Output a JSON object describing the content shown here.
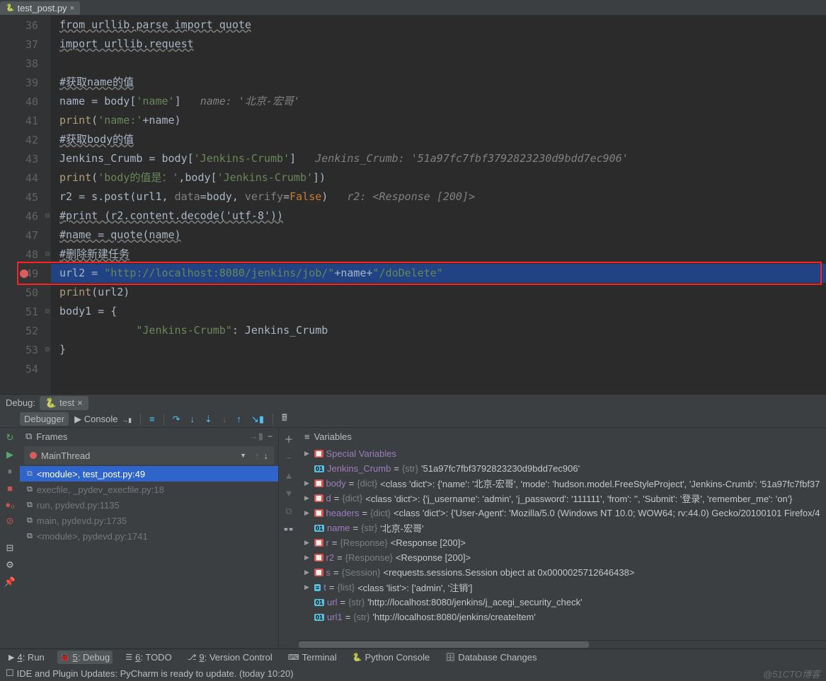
{
  "tab": {
    "filename": "test_post.py"
  },
  "code": {
    "lines": [
      {
        "n": 36,
        "segs": [
          [
            "under",
            "from urllib.parse import quote"
          ]
        ]
      },
      {
        "n": 37,
        "segs": [
          [
            "under",
            "import urllib.request"
          ]
        ]
      },
      {
        "n": 38,
        "segs": []
      },
      {
        "n": 39,
        "segs": [
          [
            "under",
            "#获取name的值"
          ]
        ]
      },
      {
        "n": 40,
        "segs": [
          [
            "ident",
            "name = body["
          ],
          [
            "str",
            "'name'"
          ],
          [
            "ident",
            "]   "
          ],
          [
            "cmt",
            "name: '北京-宏哥'"
          ]
        ]
      },
      {
        "n": 41,
        "segs": [
          [
            "fn",
            "print"
          ],
          [
            "ident",
            "("
          ],
          [
            "str",
            "'name:'"
          ],
          [
            "ident",
            "+name)"
          ]
        ]
      },
      {
        "n": 42,
        "segs": [
          [
            "under",
            "#获取body的值"
          ]
        ]
      },
      {
        "n": 43,
        "segs": [
          [
            "ident",
            "Jenkins_Crumb = body["
          ],
          [
            "str",
            "'Jenkins-Crumb'"
          ],
          [
            "ident",
            "]   "
          ],
          [
            "cmt",
            "Jenkins_Crumb: '51a97fc7fbf3792823230d9bdd7ec906'"
          ]
        ]
      },
      {
        "n": 44,
        "segs": [
          [
            "fn",
            "print"
          ],
          [
            "ident",
            "("
          ],
          [
            "str",
            "'body的值是：'"
          ],
          [
            "ident",
            ",body["
          ],
          [
            "str",
            "'Jenkins-Crumb'"
          ],
          [
            "ident",
            "])"
          ]
        ]
      },
      {
        "n": 45,
        "segs": [
          [
            "ident",
            "r2 = s.post(url1, "
          ],
          [
            "argname",
            "data"
          ],
          [
            "ident",
            "=body, "
          ],
          [
            "argname",
            "verify"
          ],
          [
            "ident",
            "="
          ],
          [
            "kw",
            "False"
          ],
          [
            "ident",
            ")   "
          ],
          [
            "cmt",
            "r2: <Response [200]>"
          ]
        ]
      },
      {
        "n": 46,
        "segs": [
          [
            "under",
            "#print (r2.content.decode('utf-8'))"
          ]
        ]
      },
      {
        "n": 47,
        "segs": [
          [
            "under",
            "#name = quote(name)"
          ]
        ]
      },
      {
        "n": 48,
        "segs": [
          [
            "under",
            "#删除新建任务"
          ]
        ]
      },
      {
        "n": 49,
        "bp": true,
        "sel": true,
        "segs": [
          [
            "ident",
            "url2 = "
          ],
          [
            "str",
            "\"http://localhost:8080/jenkins/job/\""
          ],
          [
            "ident",
            "+name+"
          ],
          [
            "str",
            "\"/doDelete\""
          ]
        ]
      },
      {
        "n": 50,
        "segs": [
          [
            "fn",
            "print"
          ],
          [
            "ident",
            "(url2)"
          ]
        ]
      },
      {
        "n": 51,
        "segs": [
          [
            "ident",
            "body1 = {"
          ]
        ]
      },
      {
        "n": 52,
        "segs": [
          [
            "ident",
            "            "
          ],
          [
            "str",
            "\"Jenkins-Crumb\""
          ],
          [
            "ident",
            ": Jenkins_Crumb"
          ]
        ]
      },
      {
        "n": 53,
        "segs": [
          [
            "ident",
            "}"
          ]
        ]
      },
      {
        "n": 54,
        "segs": []
      }
    ]
  },
  "debugHead": {
    "label": "Debug:",
    "config": "test"
  },
  "dbgTabs": {
    "debugger": "Debugger",
    "console": "Console"
  },
  "framesCol": {
    "title": "Frames",
    "thread": "MainThread",
    "items": [
      {
        "label": "<module>, test_post.py:49",
        "sel": true
      },
      {
        "label": "execfile, _pydev_execfile.py:18",
        "dim": true
      },
      {
        "label": "run, pydevd.py:1135",
        "dim": true
      },
      {
        "label": "main, pydevd.py:1735",
        "dim": true
      },
      {
        "label": "<module>, pydevd.py:1741",
        "dim": true
      }
    ]
  },
  "varsCol": {
    "title": "Variables",
    "items": [
      {
        "arrow": true,
        "badge": "grp",
        "name": "Special Variables",
        "type": "",
        "val": ""
      },
      {
        "arrow": false,
        "badge": "str",
        "name": "Jenkins_Crumb",
        "type": "{str}",
        "val": "'51a97fc7fbf3792823230d9bdd7ec906'"
      },
      {
        "arrow": true,
        "badge": "grp",
        "name": "body",
        "type": "{dict}",
        "val": "<class 'dict'>: {'name': '北京-宏哥', 'mode': 'hudson.model.FreeStyleProject', 'Jenkins-Crumb': '51a97fc7fbf37"
      },
      {
        "arrow": true,
        "badge": "grp",
        "name": "d",
        "type": "{dict}",
        "val": "<class 'dict'>: {'j_username': 'admin', 'j_password': '111111', 'from': '', 'Submit': '登录', 'remember_me': 'on'}"
      },
      {
        "arrow": true,
        "badge": "grp",
        "name": "headers",
        "type": "{dict}",
        "val": "<class 'dict'>: {'User-Agent': 'Mozilla/5.0 (Windows NT 10.0; WOW64; rv:44.0) Gecko/20100101 Firefox/4"
      },
      {
        "arrow": false,
        "badge": "str",
        "name": "name",
        "type": "{str}",
        "val": "'北京-宏哥'"
      },
      {
        "arrow": true,
        "badge": "grp",
        "name": "r",
        "type": "{Response}",
        "val": "<Response [200]>"
      },
      {
        "arrow": true,
        "badge": "grp",
        "name": "r2",
        "type": "{Response}",
        "val": "<Response [200]>"
      },
      {
        "arrow": true,
        "badge": "grp",
        "name": "s",
        "type": "{Session}",
        "val": "<requests.sessions.Session object at 0x0000025712646438>"
      },
      {
        "arrow": true,
        "badge": "lst",
        "name": "t",
        "type": "{list}",
        "val": "<class 'list'>: ['admin', '注销']"
      },
      {
        "arrow": false,
        "badge": "str",
        "name": "url",
        "type": "{str}",
        "val": "'http://localhost:8080/jenkins/j_acegi_security_check'"
      },
      {
        "arrow": false,
        "badge": "str",
        "name": "url1",
        "type": "{str}",
        "val": "'http://localhost:8080/jenkins/createItem'"
      }
    ]
  },
  "bottom": {
    "run": "4: Run",
    "debug": "5: Debug",
    "todo": "6: TODO",
    "vcs": "9: Version Control",
    "terminal": "Terminal",
    "pycon": "Python Console",
    "dbchanges": "Database Changes"
  },
  "status": {
    "msg": "IDE and Plugin Updates: PyCharm is ready to update. (today 10:20)",
    "watermark": "@51CTO博客"
  }
}
